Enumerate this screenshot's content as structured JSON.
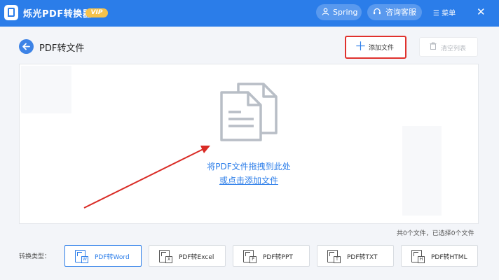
{
  "app": {
    "title": "烁光PDF转换器",
    "vip": "VIP"
  },
  "titlebar": {
    "user_label": "Spring",
    "service_label": "咨询客服",
    "menu_label": "菜单",
    "close_glyph": "✕"
  },
  "header": {
    "page_title": "PDF转文件",
    "add_file_label": "添加文件",
    "clear_list_label": "清空列表"
  },
  "drop_zone": {
    "hint_line1": "将PDF文件拖拽到此处",
    "hint_line2": "或点击添加文件"
  },
  "status": {
    "file_count": "共0个文件，已选择0个文件"
  },
  "conversion": {
    "label": "转换类型：",
    "options": [
      {
        "label": "PDF转Word",
        "tag": "W",
        "active": true
      },
      {
        "label": "PDF转Excel",
        "tag": "X",
        "active": false
      },
      {
        "label": "PDF转PPT",
        "tag": "P",
        "active": false
      },
      {
        "label": "PDF转TXT",
        "tag": "T",
        "active": false
      },
      {
        "label": "PDF转HTML",
        "tag": "H",
        "active": false
      }
    ]
  },
  "colors": {
    "brand": "#2b7de9",
    "highlight_border": "#e0312d",
    "arrow": "#d92b25",
    "vip": "#f6c24a"
  }
}
